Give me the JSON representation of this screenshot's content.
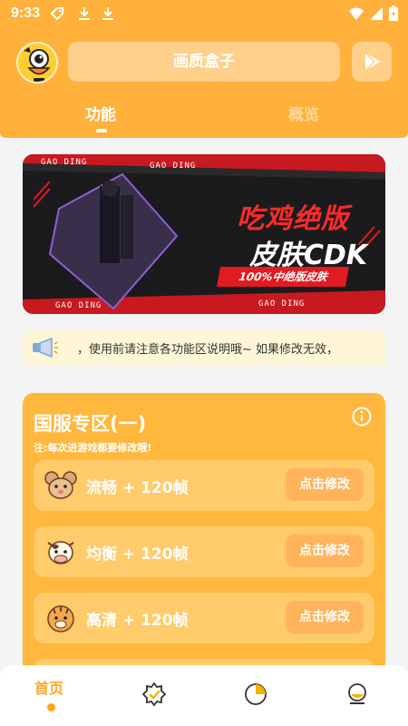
{
  "status_bar": {
    "time": "9:33"
  },
  "header": {
    "title": "画质盒子",
    "tabs": [
      {
        "label": "功能",
        "active": true
      },
      {
        "label": "概览",
        "active": false
      }
    ]
  },
  "banner": {
    "headline": "吃鸡绝版",
    "subheadline": "皮肤CDK",
    "tag": "100%中绝版皮肤",
    "strip_text": "GAO DING"
  },
  "notice": {
    "text": "，使用前请注意各功能区说明哦~      如果修改无效，"
  },
  "section": {
    "title": "国服专区(一)",
    "note": "注:每次进游戏都要修改哦!",
    "rows": [
      {
        "label": "流畅 + 120帧",
        "button": "点击修改",
        "icon": "mouse-face-icon"
      },
      {
        "label": "均衡 + 120帧",
        "button": "点击修改",
        "icon": "cow-face-icon"
      },
      {
        "label": "高清 + 120帧",
        "button": "点击修改",
        "icon": "tiger-face-icon"
      }
    ]
  },
  "bottom_nav": {
    "items": [
      {
        "label": "首页",
        "icon": "home",
        "active": true
      },
      {
        "label": "",
        "icon": "star-badge-icon",
        "active": false
      },
      {
        "label": "",
        "icon": "pie-chart-icon",
        "active": false
      },
      {
        "label": "",
        "icon": "profile-icon",
        "active": false
      }
    ]
  },
  "colors": {
    "primary": "#ffb13b",
    "accent": "#ffa51f",
    "banner_red": "#e01b22"
  }
}
